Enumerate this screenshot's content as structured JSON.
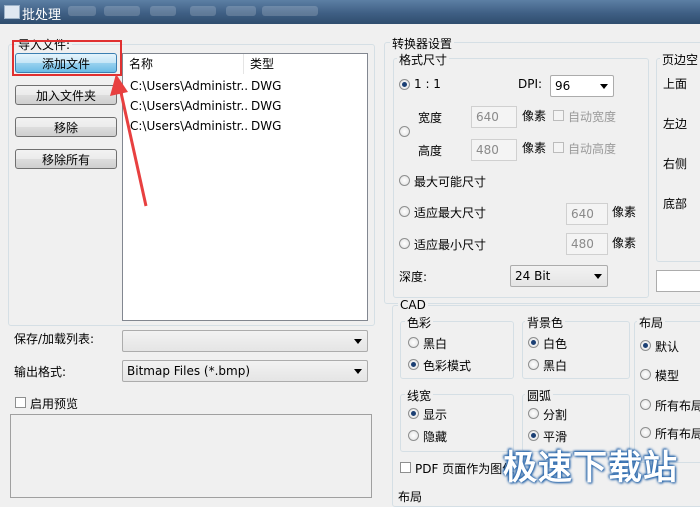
{
  "window": {
    "title": "批处理"
  },
  "import_group": {
    "label": "导入文件:",
    "buttons": {
      "add_file": "添加文件",
      "add_folder": "加入文件夹",
      "remove": "移除",
      "remove_all": "移除所有"
    },
    "columns": [
      "名称",
      "类型"
    ],
    "rows": [
      {
        "name": "C:\\Users\\Administr...",
        "type": "DWG"
      },
      {
        "name": "C:\\Users\\Administr...",
        "type": "DWG"
      },
      {
        "name": "C:\\Users\\Administr...",
        "type": "DWG"
      }
    ]
  },
  "save_load_list": {
    "label": "保存/加载列表:",
    "value": ""
  },
  "output_format": {
    "label": "输出格式:",
    "value": "Bitmap Files (*.bmp)"
  },
  "preview": {
    "label": "启用预览",
    "checked": false
  },
  "converter": {
    "label": "转换器设置",
    "format_size": {
      "label": "格式尺寸",
      "ratio_label": "1 : 1",
      "dpi_label": "DPI:",
      "dpi_value": "96",
      "width_label": "宽度",
      "width_value": "640",
      "height_label": "高度",
      "height_value": "480",
      "unit_pixels": "像素",
      "auto_width": "自动宽度",
      "auto_height": "自动高度",
      "max_possible": "最大可能尺寸",
      "fit_max": "适应最大尺寸",
      "fit_max_value": "640",
      "fit_min": "适应最小尺寸",
      "fit_min_value": "480",
      "depth_label": "深度:",
      "depth_value": "24 Bit"
    },
    "margins": {
      "label": "页边空",
      "top": "上面",
      "left": "左边",
      "right": "右侧",
      "bottom": "底部"
    }
  },
  "cad": {
    "label": "CAD",
    "color": {
      "label": "色彩",
      "options": [
        "黑白",
        "色彩模式"
      ],
      "selected": "色彩模式"
    },
    "background": {
      "label": "背景色",
      "options": [
        "白色",
        "黑白"
      ],
      "selected": "白色"
    },
    "layout": {
      "label": "布局",
      "options": [
        "默认",
        "模型",
        "所有布局",
        "所有布局"
      ],
      "selected": "默认"
    },
    "lineweight": {
      "label": "线宽",
      "options": [
        "显示",
        "隐藏"
      ],
      "selected": "显示"
    },
    "arc": {
      "label": "圆弧",
      "options": [
        "分割",
        "平滑"
      ],
      "selected": "平滑"
    },
    "pdf_as_image": "PDF 页面作为图像",
    "bottom_label": "布局"
  },
  "watermark": "极速下载站",
  "colors": {
    "highlight_box": "#e03030",
    "arrow": "#e84040",
    "titlebar": "#3f5f84"
  }
}
